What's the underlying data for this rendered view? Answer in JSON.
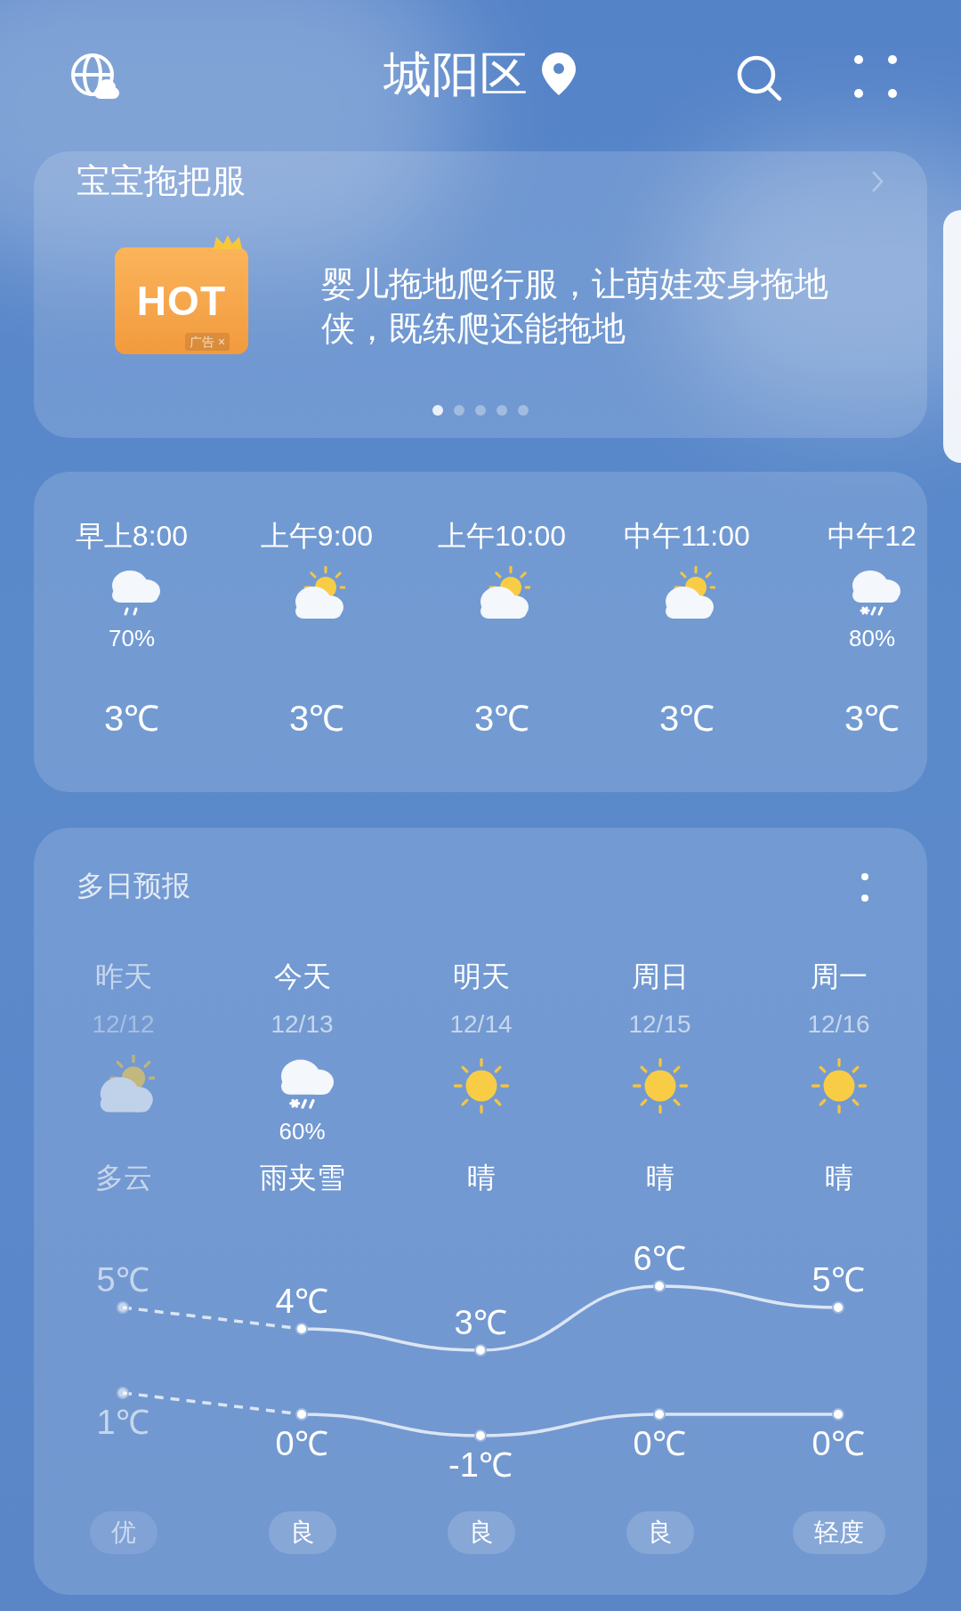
{
  "header": {
    "location": "城阳区"
  },
  "ad": {
    "title": "宝宝拖把服",
    "image_text": "HOT",
    "ad_label": "广告",
    "close": "×",
    "text": "婴儿拖地爬行服，让萌娃变身拖地侠，既练爬还能拖地",
    "pages": [
      {
        "selected": true
      },
      {
        "selected": false
      },
      {
        "selected": false
      },
      {
        "selected": false
      },
      {
        "selected": false
      }
    ]
  },
  "hourly": [
    {
      "time": "早上8:00",
      "kind": "rain",
      "precip": "70%",
      "temp": "3℃"
    },
    {
      "time": "上午9:00",
      "kind": "partly_cloudy",
      "temp": "3℃"
    },
    {
      "time": "上午10:00",
      "kind": "partly_cloudy",
      "temp": "3℃"
    },
    {
      "time": "中午11:00",
      "kind": "partly_cloudy",
      "temp": "3℃"
    },
    {
      "time": "中午12",
      "kind": "sleet",
      "precip": "80%",
      "temp": "3℃"
    }
  ],
  "daily": {
    "title": "多日预报",
    "days": [
      {
        "day": "昨天",
        "date": "12/12",
        "kind": "partly_cloudy",
        "condition": "多云",
        "high": "5℃",
        "low": "1℃",
        "aqi": "优",
        "past": true
      },
      {
        "day": "今天",
        "date": "12/13",
        "kind": "sleet",
        "precip": "60%",
        "condition": "雨夹雪",
        "high": "4℃",
        "low": "0℃",
        "aqi": "良",
        "past": false
      },
      {
        "day": "明天",
        "date": "12/14",
        "kind": "sun",
        "condition": "晴",
        "high": "3℃",
        "low": "-1℃",
        "aqi": "良",
        "past": false
      },
      {
        "day": "周日",
        "date": "12/15",
        "kind": "sun",
        "condition": "晴",
        "high": "6℃",
        "low": "0℃",
        "aqi": "良",
        "past": false
      },
      {
        "day": "周一",
        "date": "12/16",
        "kind": "sun",
        "condition": "晴",
        "high": "5℃",
        "low": "0℃",
        "aqi": "轻度",
        "past": false
      }
    ]
  }
}
